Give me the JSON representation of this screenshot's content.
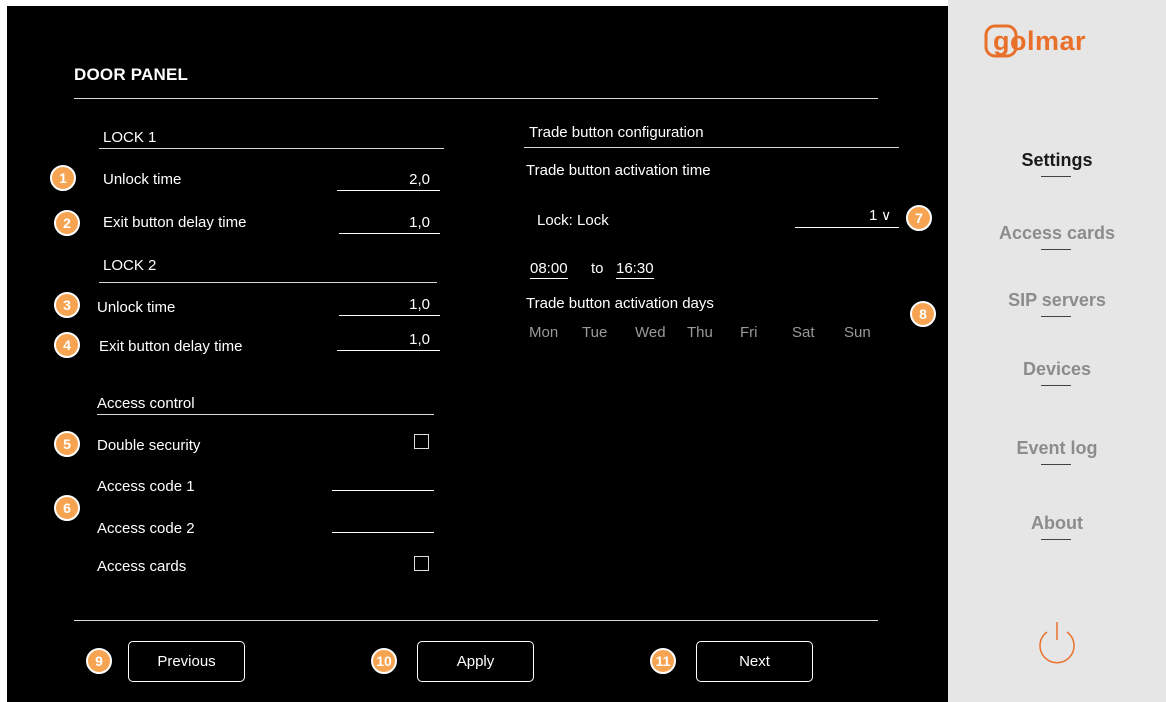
{
  "page_title": "DOOR PANEL",
  "lock1": {
    "heading": "LOCK 1",
    "unlock_label": "Unlock time",
    "unlock_value": "2,0",
    "exit_label": "Exit button delay time",
    "exit_value": "1,0"
  },
  "lock2": {
    "heading": "LOCK 2",
    "unlock_label": "Unlock time",
    "unlock_value": "1,0",
    "exit_label": "Exit button delay time",
    "exit_value": "1,0"
  },
  "access_control": {
    "heading": "Access control",
    "double_security_label": "Double security",
    "double_security_checked": false,
    "code1_label": "Access code 1",
    "code1_value": "",
    "code2_label": "Access code 2",
    "code2_value": "",
    "cards_label": "Access cards",
    "cards_checked": false
  },
  "trade": {
    "heading": "Trade button configuration",
    "activation_time_label": "Trade button activation time",
    "lock_label": "Lock: Lock",
    "lock_value": "1",
    "lock_dropdown_glyph": "∨",
    "start_time": "08:00",
    "to_label": "to",
    "end_time": "16:30",
    "days_label": "Trade button activation days",
    "days": [
      "Mon",
      "Tue",
      "Wed",
      "Thu",
      "Fri",
      "Sat",
      "Sun"
    ]
  },
  "buttons": {
    "previous": "Previous",
    "apply": "Apply",
    "next": "Next"
  },
  "badges": [
    "1",
    "2",
    "3",
    "4",
    "5",
    "6",
    "7",
    "8",
    "9",
    "10",
    "11"
  ],
  "sidebar": {
    "logo_text": "golmar",
    "items": [
      {
        "label": "Settings",
        "active": true
      },
      {
        "label": "Access cards",
        "active": false
      },
      {
        "label": "SIP servers",
        "active": false
      },
      {
        "label": "Devices",
        "active": false
      },
      {
        "label": "Event log",
        "active": false
      },
      {
        "label": "About",
        "active": false
      }
    ],
    "power_icon": "power-icon"
  },
  "colors": {
    "accent": "#f7a452",
    "logo": "#e8702a",
    "background": "#000000",
    "sidebar_bg": "#e6e6e6"
  }
}
